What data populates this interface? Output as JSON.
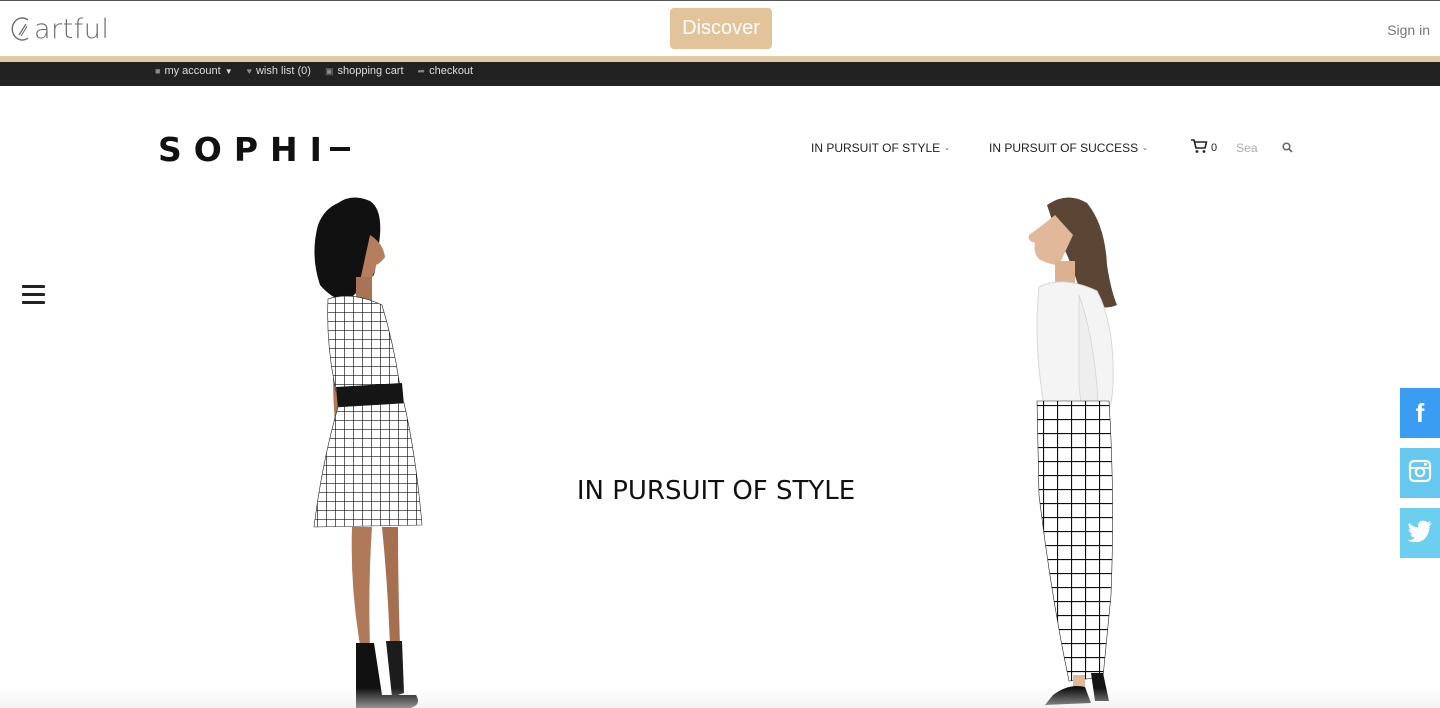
{
  "cartful_bar": {
    "logo_text": "artful",
    "discover_label": "Discover",
    "signin_label": "Sign in",
    "accent_color": "#e3c39a"
  },
  "account_bar": {
    "items": [
      {
        "label": "my account",
        "icon": "user-icon"
      },
      {
        "label": "wish list (0)",
        "icon": "heart-icon"
      },
      {
        "label": "shopping cart",
        "icon": "cart-icon"
      },
      {
        "label": "checkout",
        "icon": "share-arrow-icon"
      }
    ]
  },
  "header": {
    "logo": "SOPHI",
    "nav": [
      {
        "label": "IN PURSUIT OF STYLE"
      },
      {
        "label": "IN PURSUIT OF SUCCESS"
      }
    ],
    "cart_count": "0",
    "search_placeholder": "Sea"
  },
  "hero": {
    "title": "IN PURSUIT OF STYLE"
  },
  "social": {
    "facebook_glyph": "f",
    "colors": {
      "facebook": "#3b9df2",
      "instagram": "#66c8ee",
      "twitter": "#6ccfef"
    }
  }
}
